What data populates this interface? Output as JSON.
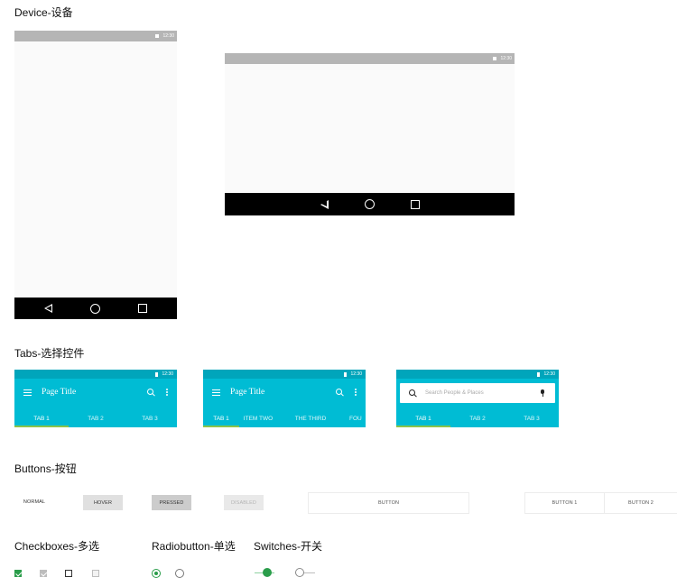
{
  "sections": {
    "device": "Device-设备",
    "tabs": "Tabs-选择控件",
    "buttons": "Buttons-按钮",
    "checkboxes": "Checkboxes-多选",
    "radiobutton": "Radiobutton-单选",
    "switches": "Switches-开关"
  },
  "device_status_time": "12:30",
  "tabs_components": [
    {
      "status_time": "12:30",
      "title": "Page Title",
      "tabs": [
        "TAB 1",
        "TAB 2",
        "TAB 3"
      ]
    },
    {
      "status_time": "12:30",
      "title": "Page Title",
      "tabs": [
        "TAB 1",
        "ITEM TWO",
        "THE THIRD",
        "FOU"
      ]
    },
    {
      "status_time": "12:30",
      "search_placeholder": "Search People & Places",
      "tabs": [
        "TAB 1",
        "TAB 2",
        "TAB 3"
      ]
    }
  ],
  "buttons": {
    "normal": "NORMAL",
    "hover": "HOVER",
    "pressed": "PRESSED",
    "disabled": "DISABLED",
    "button": "BUTTON",
    "button_1": "BUTTON 1",
    "button_2": "BUTTON 2"
  },
  "colors": {
    "accent_green": "#2a9d4a",
    "tab_bg": "#00bcd4",
    "tab_status_bg": "#00a5bb",
    "tab_indicator": "#8bc34a",
    "status_gray": "#b5b5b5"
  },
  "icons": {
    "nav_back": "back-triangle-icon",
    "nav_home": "home-circle-icon",
    "nav_recent": "recent-square-icon",
    "menu": "hamburger-menu-icon",
    "search": "search-icon",
    "more": "more-vertical-icon",
    "mic": "mic-icon",
    "battery": "battery-icon"
  },
  "controls": {
    "checkboxes": [
      "checked",
      "checked-disabled",
      "unchecked",
      "unchecked-disabled"
    ],
    "radios": [
      "selected",
      "unselected"
    ],
    "switches": [
      "on",
      "off"
    ]
  }
}
